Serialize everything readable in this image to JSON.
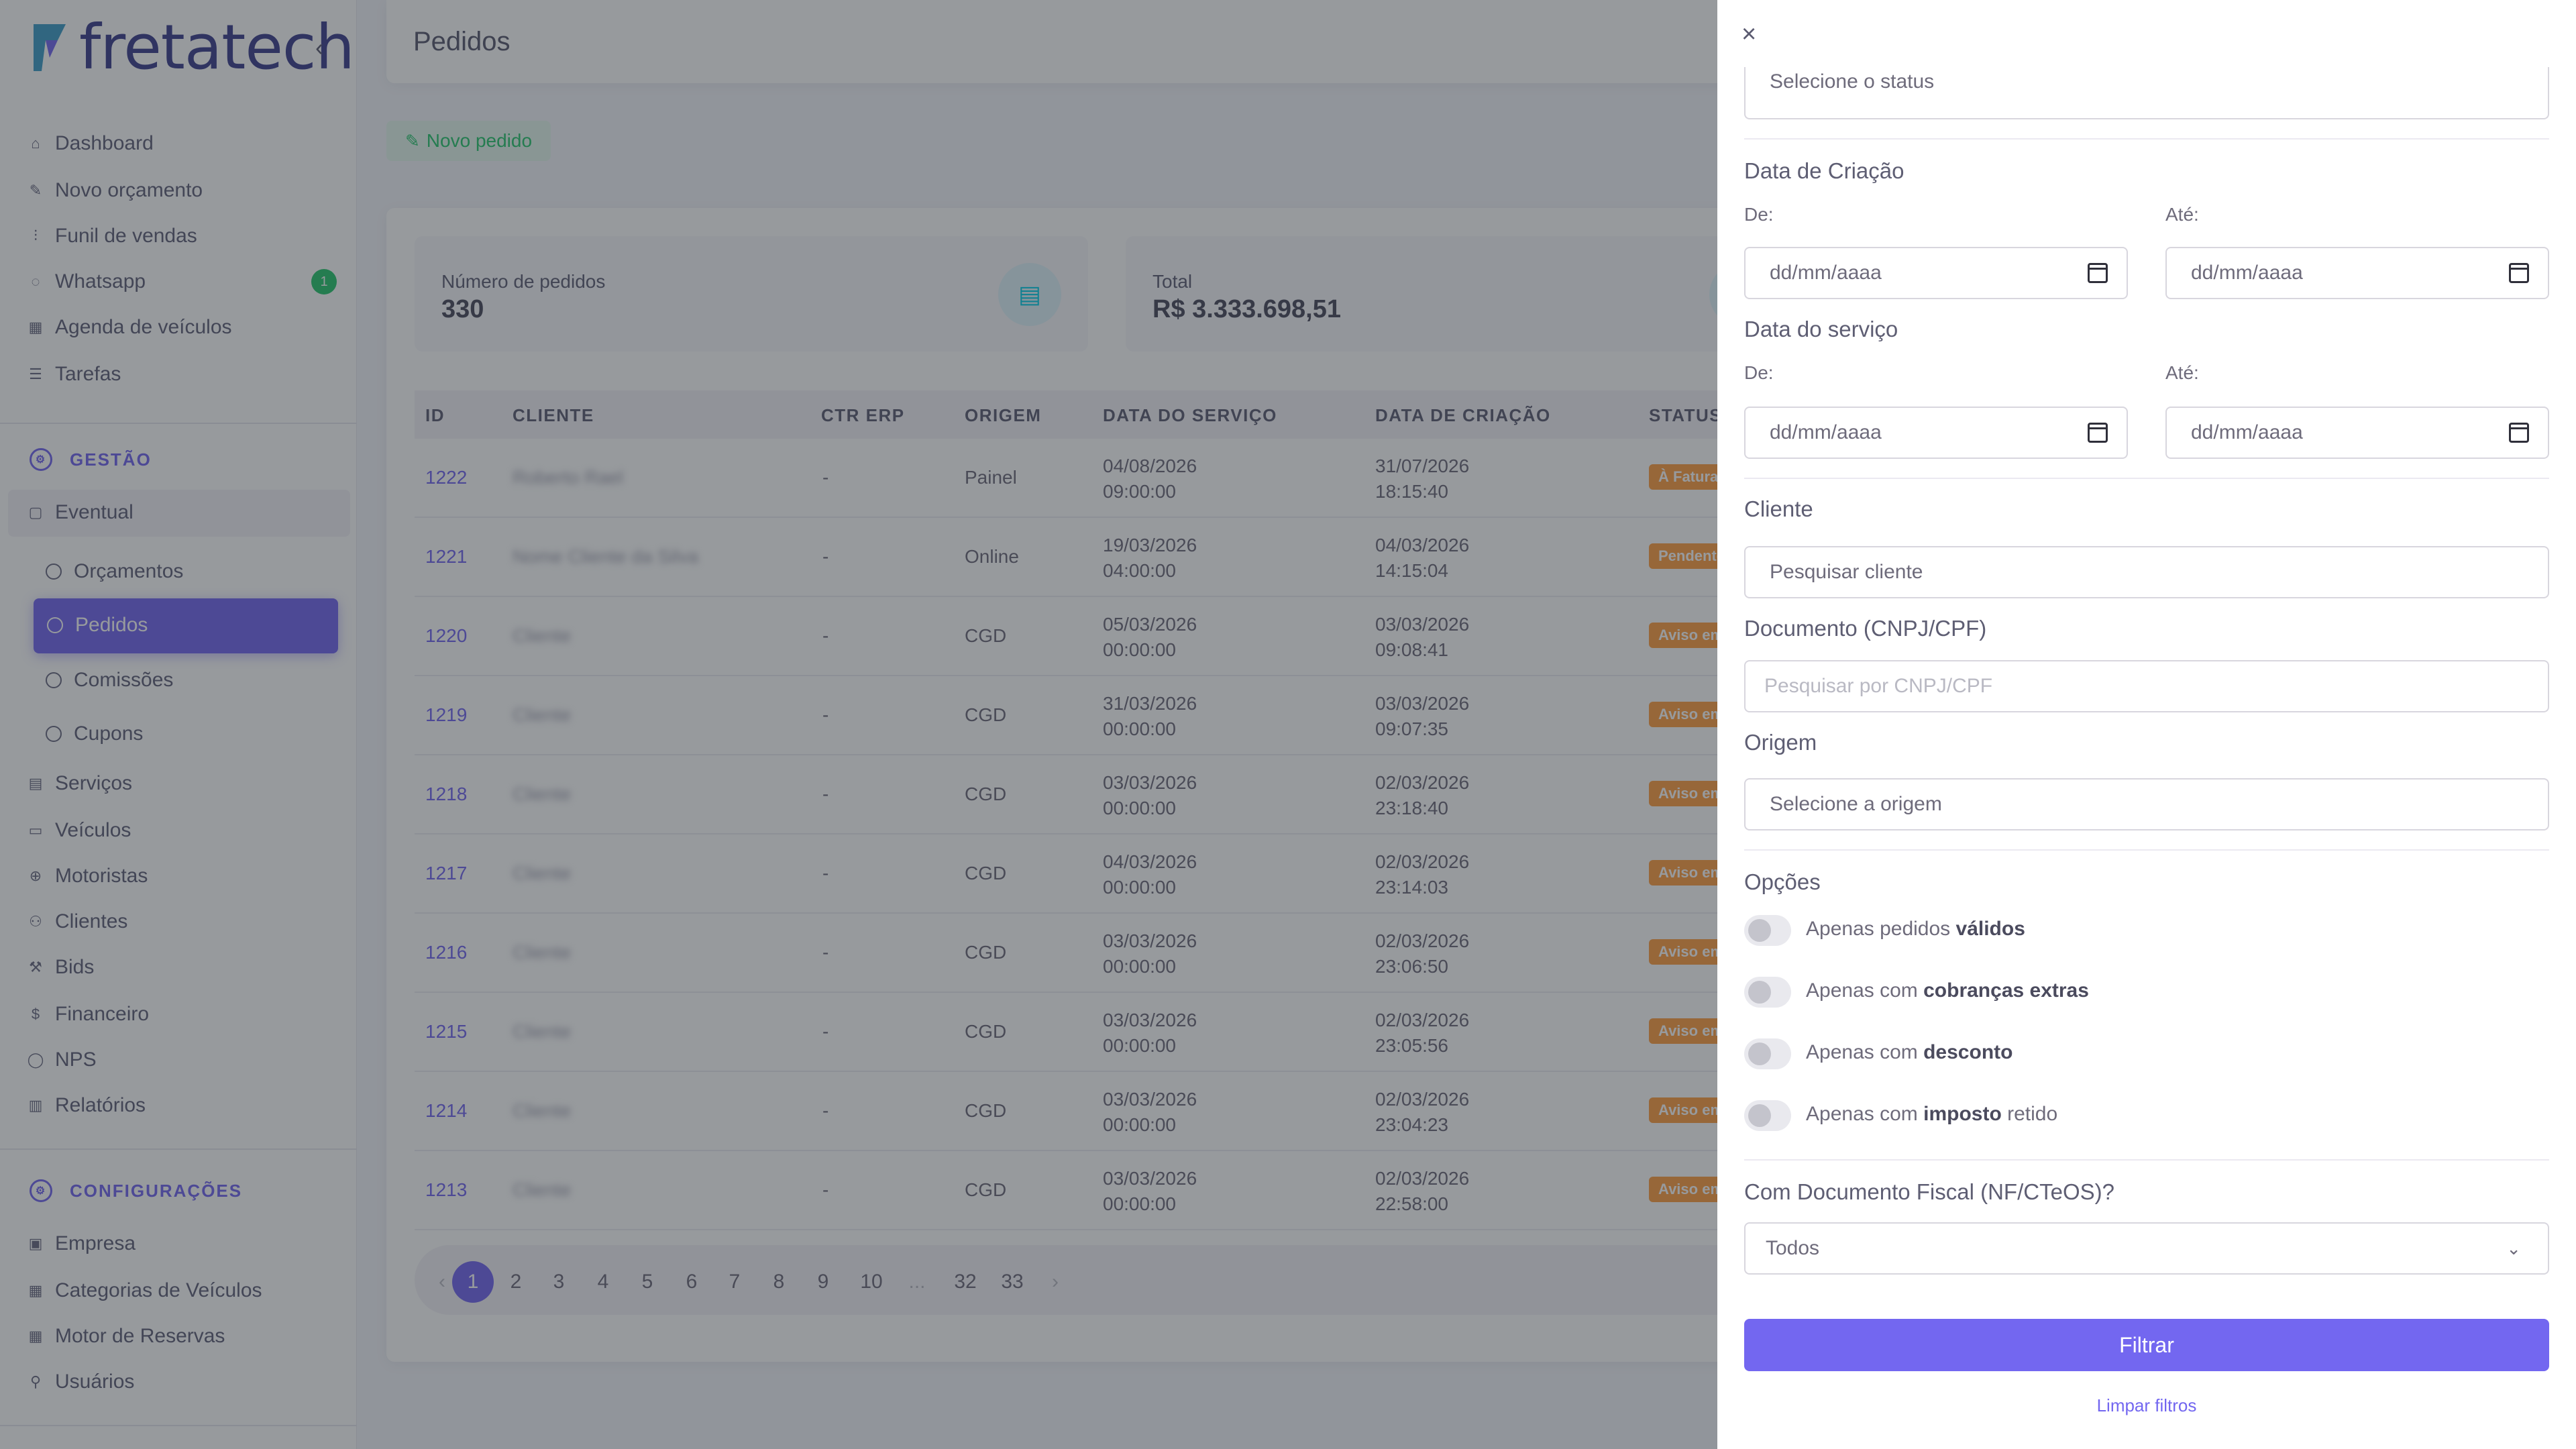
{
  "brand": {
    "name": "fretatech",
    "logo_colors": [
      "#3f9ec9",
      "#7367f0"
    ]
  },
  "sidebar": {
    "collapse_icon": "chevron-left",
    "items": [
      {
        "label": "Dashboard",
        "icon": "home"
      },
      {
        "label": "Novo orçamento",
        "icon": "edit"
      },
      {
        "label": "Funil de vendas",
        "icon": "funnel"
      },
      {
        "label": "Whatsapp",
        "icon": "chat",
        "badge": "1"
      },
      {
        "label": "Agenda de veículos",
        "icon": "calendar"
      },
      {
        "label": "Tarefas",
        "icon": "list"
      }
    ],
    "section_gestao": "GESTÃO",
    "group": {
      "label": "Eventual",
      "icon": "file"
    },
    "subitems": [
      {
        "label": "Orçamentos"
      },
      {
        "label": "Pedidos",
        "active": true
      },
      {
        "label": "Comissões"
      },
      {
        "label": "Cupons"
      }
    ],
    "gestao_items": [
      {
        "label": "Serviços",
        "icon": "clipboard"
      },
      {
        "label": "Veículos",
        "icon": "bus"
      },
      {
        "label": "Motoristas",
        "icon": "steering-wheel"
      },
      {
        "label": "Clientes",
        "icon": "users"
      },
      {
        "label": "Bids",
        "icon": "gavel"
      },
      {
        "label": "Financeiro",
        "icon": "dollar"
      },
      {
        "label": "NPS",
        "icon": "message"
      },
      {
        "label": "Relatórios",
        "icon": "report"
      }
    ],
    "section_config": "CONFIGURAÇÕES",
    "config_items": [
      {
        "label": "Empresa",
        "icon": "building"
      },
      {
        "label": "Categorias de Veículos",
        "icon": "grid"
      },
      {
        "label": "Motor de Reservas",
        "icon": "table"
      },
      {
        "label": "Usuários",
        "icon": "user"
      }
    ]
  },
  "header": {
    "title": "Pedidos"
  },
  "new_order_label": "Novo pedido",
  "stats": [
    {
      "label": "Número de pedidos",
      "value": "330",
      "icon": "document"
    },
    {
      "label": "Total",
      "value": "R$ 3.333.698,51",
      "icon": "dollar"
    }
  ],
  "table": {
    "columns": [
      "ID",
      "CLIENTE",
      "CTR ERP",
      "ORIGEM",
      "DATA DO SERVIÇO",
      "DATA DE CRIAÇÃO",
      "STATUS"
    ],
    "rows": [
      {
        "id": "1222",
        "client": "Roberto Rael",
        "erp": "-",
        "origin": "Painel",
        "service_date": "04/08/2026",
        "service_time": "09:00:00",
        "created_date": "31/07/2026",
        "created_time": "18:15:40",
        "status": "À Fatura",
        "status_color": "#ff9f43"
      },
      {
        "id": "1221",
        "client": "Nome Cliente da Silva",
        "erp": "-",
        "origin": "Online",
        "service_date": "19/03/2026",
        "service_time": "04:00:00",
        "created_date": "04/03/2026",
        "created_time": "14:15:04",
        "status": "Pendente",
        "status_color": "#ff9f43"
      },
      {
        "id": "1220",
        "client": "Cliente",
        "erp": "-",
        "origin": "CGD",
        "service_date": "05/03/2026",
        "service_time": "00:00:00",
        "created_date": "03/03/2026",
        "created_time": "09:08:41",
        "status": "Aviso em",
        "status_color": "#ff9f43"
      },
      {
        "id": "1219",
        "client": "Cliente",
        "erp": "-",
        "origin": "CGD",
        "service_date": "31/03/2026",
        "service_time": "00:00:00",
        "created_date": "03/03/2026",
        "created_time": "09:07:35",
        "status": "Aviso em",
        "status_color": "#ff9f43"
      },
      {
        "id": "1218",
        "client": "Cliente",
        "erp": "-",
        "origin": "CGD",
        "service_date": "03/03/2026",
        "service_time": "00:00:00",
        "created_date": "02/03/2026",
        "created_time": "23:18:40",
        "status": "Aviso em",
        "status_color": "#ff9f43"
      },
      {
        "id": "1217",
        "client": "Cliente",
        "erp": "-",
        "origin": "CGD",
        "service_date": "04/03/2026",
        "service_time": "00:00:00",
        "created_date": "02/03/2026",
        "created_time": "23:14:03",
        "status": "Aviso em",
        "status_color": "#ff9f43"
      },
      {
        "id": "1216",
        "client": "Cliente",
        "erp": "-",
        "origin": "CGD",
        "service_date": "03/03/2026",
        "service_time": "00:00:00",
        "created_date": "02/03/2026",
        "created_time": "23:06:50",
        "status": "Aviso em",
        "status_color": "#ff9f43"
      },
      {
        "id": "1215",
        "client": "Cliente",
        "erp": "-",
        "origin": "CGD",
        "service_date": "03/03/2026",
        "service_time": "00:00:00",
        "created_date": "02/03/2026",
        "created_time": "23:05:56",
        "status": "Aviso em",
        "status_color": "#ff9f43"
      },
      {
        "id": "1214",
        "client": "Cliente",
        "erp": "-",
        "origin": "CGD",
        "service_date": "03/03/2026",
        "service_time": "00:00:00",
        "created_date": "02/03/2026",
        "created_time": "23:04:23",
        "status": "Aviso em",
        "status_color": "#ff9f43"
      },
      {
        "id": "1213",
        "client": "Cliente",
        "erp": "-",
        "origin": "CGD",
        "service_date": "03/03/2026",
        "service_time": "00:00:00",
        "created_date": "02/03/2026",
        "created_time": "22:58:00",
        "status": "Aviso em",
        "status_color": "#ff9f43"
      }
    ]
  },
  "pagination": {
    "prev": "‹",
    "pages": [
      "1",
      "2",
      "3",
      "4",
      "5",
      "6",
      "7",
      "8",
      "9",
      "10",
      "...",
      "32",
      "33"
    ],
    "next": "›",
    "current": "1"
  },
  "filter": {
    "close_icon": "close",
    "status_placeholder": "Selecione o status",
    "created_title": "Data de Criação",
    "service_title": "Data do serviço",
    "from_label": "De:",
    "to_label": "Até:",
    "date_placeholder": "dd/mm/aaaa",
    "client_title": "Cliente",
    "client_placeholder": "Pesquisar cliente",
    "document_title": "Documento (CNPJ/CPF)",
    "document_placeholder": "Pesquisar por CNPJ/CPF",
    "origin_title": "Origem",
    "origin_placeholder": "Selecione a origem",
    "options_title": "Opções",
    "options": [
      {
        "prefix": "Apenas pedidos",
        "bold": "válidos",
        "suffix": ""
      },
      {
        "prefix": "Apenas com",
        "bold": "cobranças extras",
        "suffix": ""
      },
      {
        "prefix": "Apenas com",
        "bold": "desconto",
        "suffix": ""
      },
      {
        "prefix": "Apenas com",
        "bold": "imposto",
        "suffix": "retido"
      }
    ],
    "fiscal_title": "Com Documento Fiscal (NF/CTeOS)?",
    "fiscal_value": "Todos",
    "submit": "Filtrar",
    "clear": "Limpar filtros"
  },
  "colors": {
    "primary": "#7367f0",
    "success": "#28c76f",
    "warning": "#ff9f43",
    "info": "#00cfe8"
  }
}
